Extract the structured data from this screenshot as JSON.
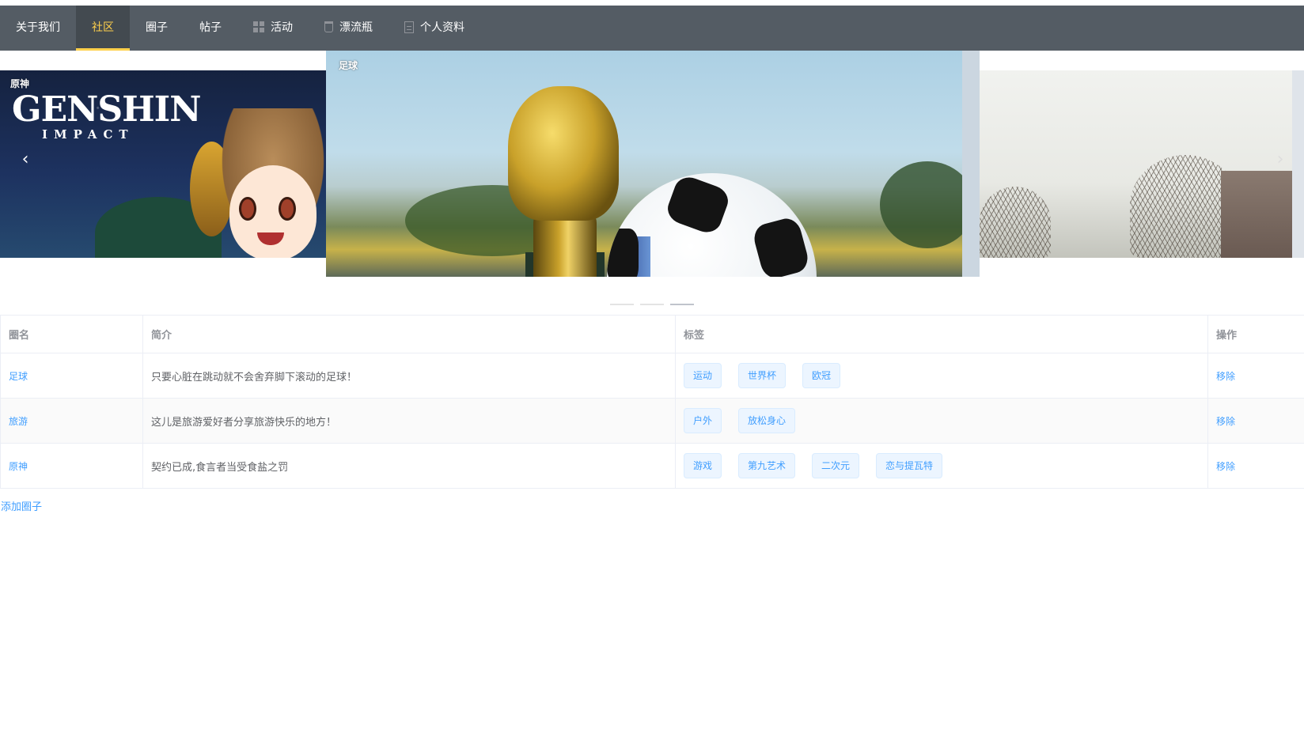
{
  "nav": {
    "items": [
      {
        "label": "关于我们",
        "icon": ""
      },
      {
        "label": "社区",
        "icon": "",
        "active": true
      },
      {
        "label": "圈子",
        "icon": ""
      },
      {
        "label": "帖子",
        "icon": ""
      },
      {
        "label": "活动",
        "icon": "grid-icon"
      },
      {
        "label": "漂流瓶",
        "icon": "bottle-icon"
      },
      {
        "label": "个人资料",
        "icon": "document-icon"
      }
    ],
    "active_color": "#ffd04b",
    "background": "#545c64"
  },
  "carousel": {
    "slides": [
      {
        "label": "原神",
        "logo_title": "GENSHIN",
        "logo_subtitle": "IMPACT"
      },
      {
        "label": "足球"
      },
      {
        "label": ""
      }
    ],
    "prev_icon": "chevron-left-icon",
    "next_icon": "chevron-right-icon",
    "prev_glyph": "‹",
    "next_glyph": "›",
    "active_index": 2,
    "indicator_count": 3
  },
  "table": {
    "headers": {
      "name": "圈名",
      "intro": "简介",
      "tags": "标签",
      "action": "操作"
    },
    "rows": [
      {
        "name": "足球",
        "intro": "只要心脏在跳动就不会舍弃脚下滚动的足球！",
        "tags": [
          "运动",
          "世界杯",
          "欧冠"
        ],
        "action": "移除"
      },
      {
        "name": "旅游",
        "intro": "这儿是旅游爱好者分享旅游快乐的地方！",
        "tags": [
          "户外",
          "放松身心"
        ],
        "action": "移除"
      },
      {
        "name": "原神",
        "intro": "契约已成,食言者当受食盐之罚",
        "tags": [
          "游戏",
          "第九艺术",
          "二次元",
          "恋与提瓦特"
        ],
        "action": "移除"
      }
    ]
  },
  "add_circle_label": "添加圈子",
  "colors": {
    "link": "#409eff",
    "tag_bg": "#ecf5ff",
    "tag_border": "#d9ecff"
  }
}
